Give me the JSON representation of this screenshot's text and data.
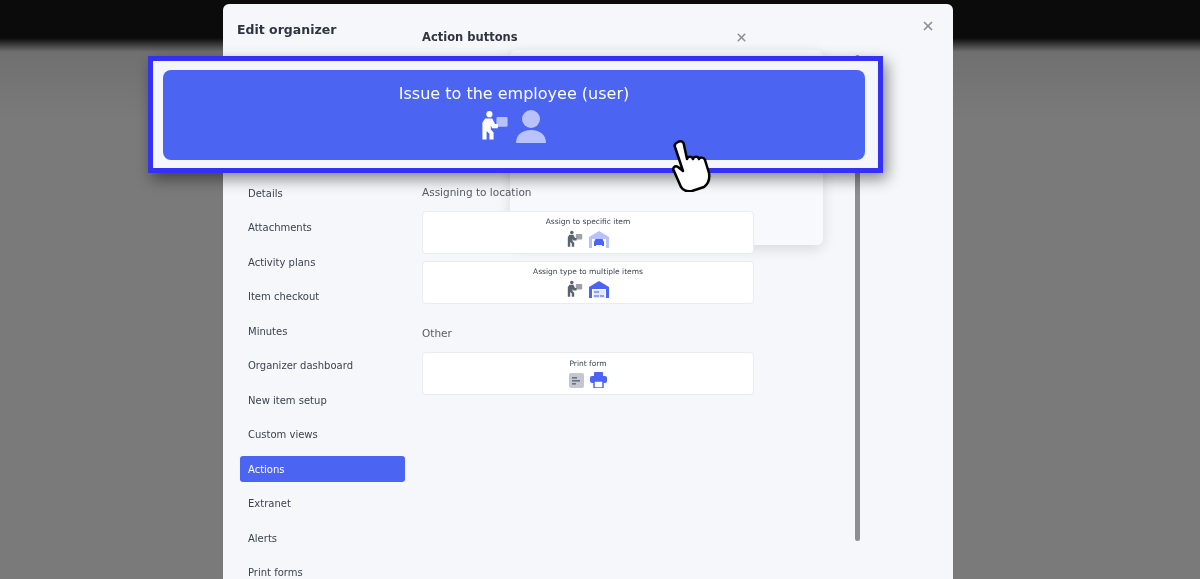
{
  "window": {
    "title": "Edit organizer"
  },
  "nav": [
    {
      "label": "Details",
      "selected": false
    },
    {
      "label": "Attachments",
      "selected": false
    },
    {
      "label": "Activity plans",
      "selected": false
    },
    {
      "label": "Item checkout",
      "selected": false
    },
    {
      "label": "Minutes",
      "selected": false
    },
    {
      "label": "Organizer dashboard",
      "selected": false
    },
    {
      "label": "New item setup",
      "selected": false
    },
    {
      "label": "Custom views",
      "selected": false
    },
    {
      "label": "Actions",
      "selected": true
    },
    {
      "label": "Extranet",
      "selected": false
    },
    {
      "label": "Alerts",
      "selected": false
    },
    {
      "label": "Print forms",
      "selected": false
    }
  ],
  "panel": {
    "title": "Action buttons",
    "sections": [
      {
        "heading": "Assigning to location",
        "actions": [
          {
            "label": "Assign to specific item"
          },
          {
            "label": "Assign type to multiple items"
          }
        ]
      },
      {
        "heading": "Other",
        "actions": [
          {
            "label": "Print form"
          }
        ]
      }
    ]
  },
  "callout": {
    "label": "Issue to the employee (user)"
  }
}
